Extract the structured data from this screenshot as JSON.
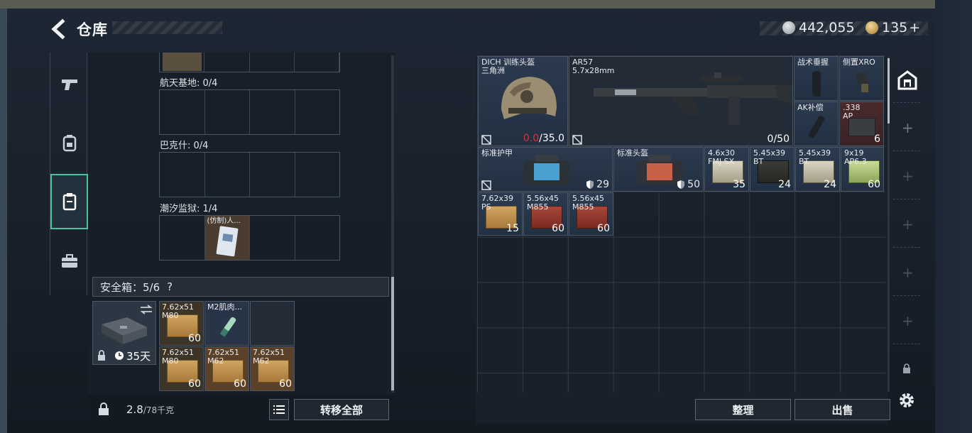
{
  "header": {
    "title": "仓库",
    "currency_1": "442,055",
    "currency_2": "135",
    "currency_2_plus": "+"
  },
  "nav": {
    "items": [
      {
        "name": "weapons",
        "icon": "pistol-icon"
      },
      {
        "name": "equipment",
        "icon": "backpack-icon"
      },
      {
        "name": "safe-box",
        "icon": "clipboard-icon",
        "active": true
      },
      {
        "name": "storage",
        "icon": "briefcase-icon"
      }
    ]
  },
  "left": {
    "maps": [
      {
        "label": "航天基地: 0/4"
      },
      {
        "label": "巴克什: 0/4"
      },
      {
        "label": "潮汐监狱: 1/4"
      }
    ],
    "prison_item_label": "(仿制)人...",
    "safebox_label": "安全箱：5/6",
    "safebox_help": "?",
    "case_days": "35天",
    "safe_items": [
      {
        "label": "7.62x51",
        "sub": "M80",
        "count": "60",
        "color": "ammo"
      },
      {
        "label": "M2肌肉...",
        "sub": "",
        "count": "",
        "color": "med"
      },
      {
        "label": "",
        "sub": "",
        "count": "",
        "color": "empty"
      },
      {
        "label": "7.62x51",
        "sub": "M80",
        "count": "60",
        "color": "ammo"
      },
      {
        "label": "7.62x51",
        "sub": "M62",
        "count": "60",
        "color": "ammo"
      },
      {
        "label": "7.62x51",
        "sub": "M62",
        "count": "60",
        "color": "ammo"
      }
    ],
    "weight_value": "2.8",
    "weight_max": "/78千克",
    "transfer_all": "转移全部"
  },
  "right": {
    "helmet": {
      "label": "DICH 训练头盔",
      "sub": "三角洲",
      "durability_current": "0.0",
      "durability_max": "/35.0"
    },
    "rifle": {
      "label": "AR57",
      "sub": "5.7x28mm",
      "ammo": "0/50"
    },
    "grip": {
      "label": "战术垂握"
    },
    "sight": {
      "label": "侧置XRO"
    },
    "muzzle": {
      "label": "AK补偿"
    },
    "ammo_338": {
      "label": ".338",
      "sub": "AP",
      "count": "6"
    },
    "armor": {
      "label": "标准护甲",
      "value": "29"
    },
    "helm2": {
      "label": "标准头盔",
      "value": "50"
    },
    "ammo_row": [
      {
        "label": "4.6x30",
        "sub": "FMJ SX",
        "count": "35",
        "box": "grey"
      },
      {
        "label": "5.45x39",
        "sub": "BT",
        "count": "24",
        "box": "ammo"
      },
      {
        "label": "5.45x39",
        "sub": "BT",
        "count": "24",
        "box": "grey"
      },
      {
        "label": "9x19",
        "sub": "AP6.3",
        "count": "60",
        "box": "green"
      }
    ],
    "ammo_row2": [
      {
        "label": "7.62x39",
        "sub": "PS",
        "count": "15",
        "box": "ammo"
      },
      {
        "label": "5.56x45",
        "sub": "M855",
        "count": "60",
        "box": "red"
      },
      {
        "label": "5.56x45",
        "sub": "M855",
        "count": "60",
        "box": "red"
      }
    ],
    "sort_button": "整理",
    "sell_button": "出售"
  },
  "colors": {
    "accent": "#49c3a0",
    "durability_low": "#e0303a"
  }
}
